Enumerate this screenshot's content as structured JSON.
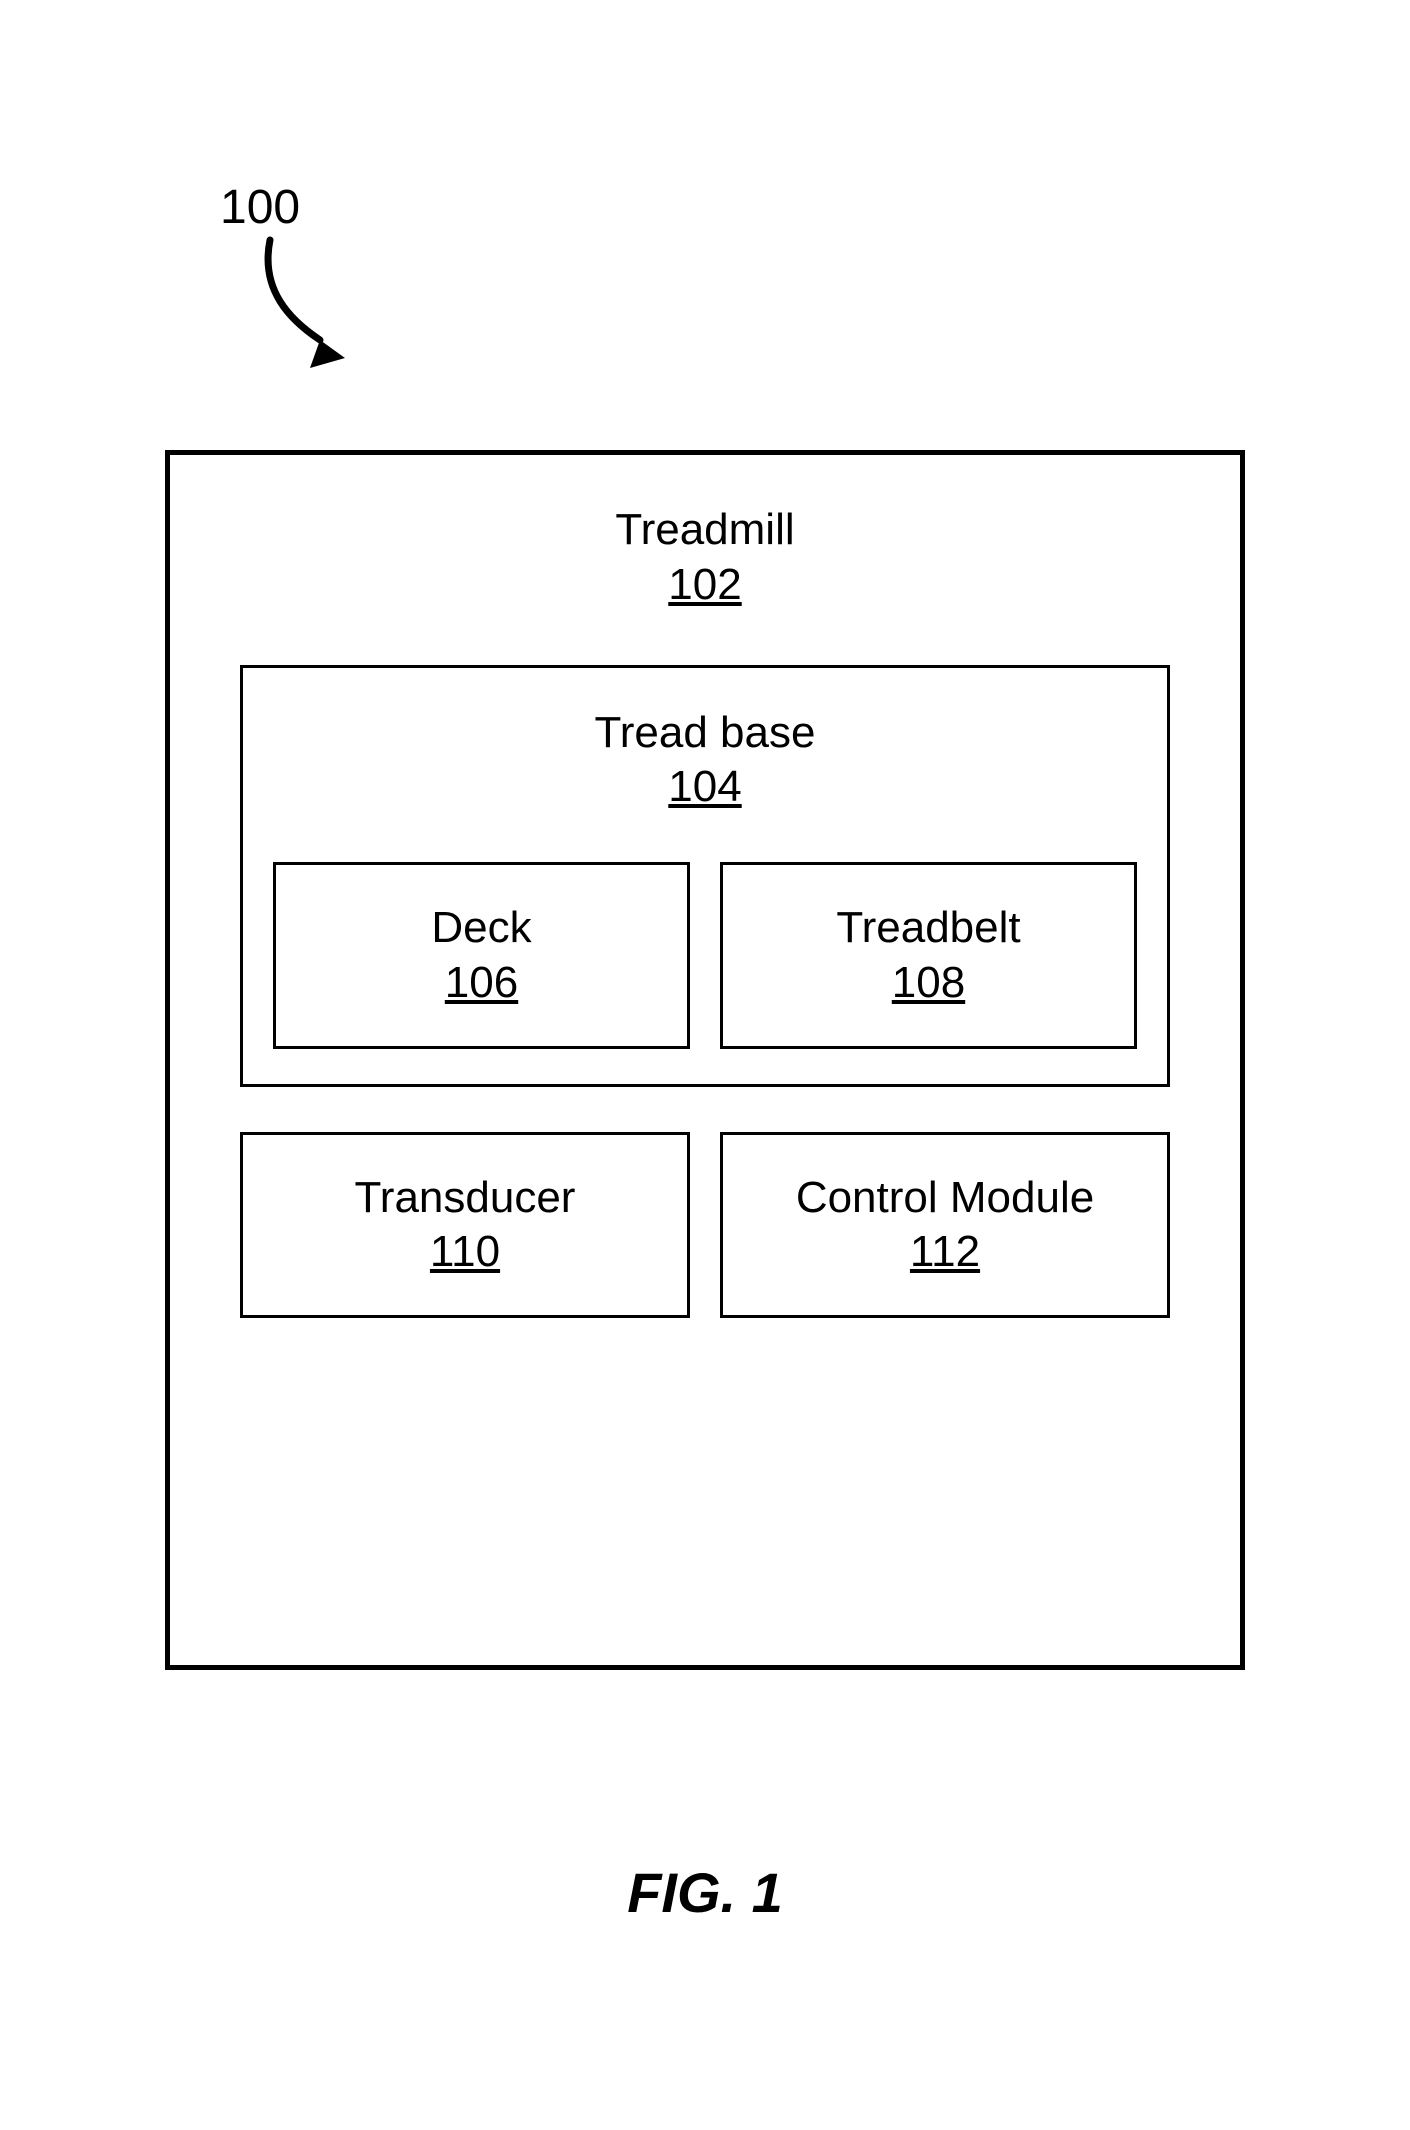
{
  "pointer": {
    "label": "100"
  },
  "treadmill": {
    "title": "Treadmill",
    "ref": "102",
    "treadbase": {
      "title": "Tread base",
      "ref": "104",
      "deck": {
        "title": "Deck",
        "ref": "106"
      },
      "treadbelt": {
        "title": "Treadbelt",
        "ref": "108"
      }
    },
    "transducer": {
      "title": "Transducer",
      "ref": "110"
    },
    "control_module": {
      "title": "Control Module",
      "ref": "112"
    }
  },
  "figure_caption": "FIG. 1"
}
